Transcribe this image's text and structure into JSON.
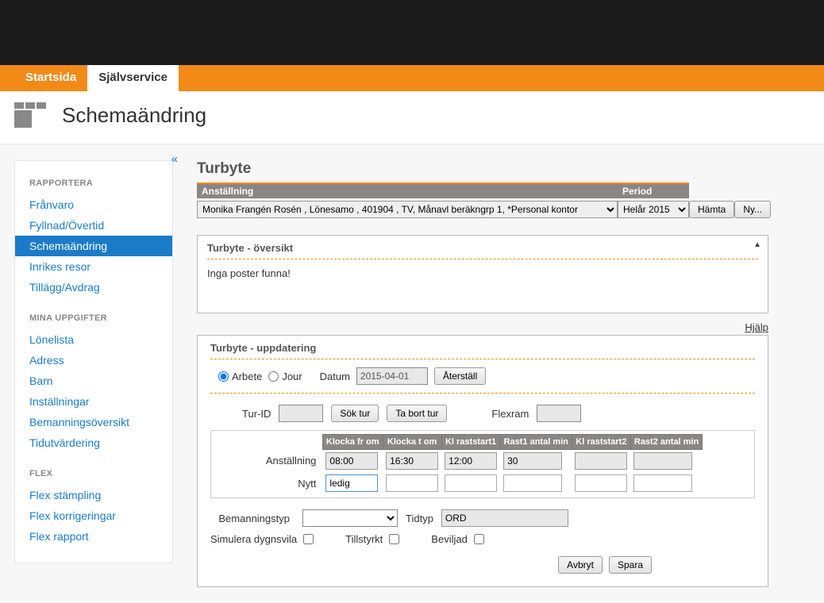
{
  "nav": {
    "tabs": [
      "Startsida",
      "Självservice"
    ],
    "active": 1
  },
  "page_title": "Schemaändring",
  "sidebar": {
    "collapse_glyph": "«",
    "sections": [
      {
        "heading": "RAPPORTERA",
        "items": [
          "Frånvaro",
          "Fyllnad/Övertid",
          "Schemaändring",
          "Inrikes resor",
          "Tillägg/Avdrag"
        ],
        "active_index": 2
      },
      {
        "heading": "MINA UPPGIFTER",
        "items": [
          "Lönelista",
          "Adress",
          "Barn",
          "Inställningar",
          "Bemanningsöversikt",
          "Tidutvärdering"
        ]
      },
      {
        "heading": "FLEX",
        "items": [
          "Flex stämpling",
          "Flex korrigeringar",
          "Flex rapport"
        ]
      }
    ]
  },
  "main": {
    "heading": "Turbyte",
    "filter": {
      "col_anst": "Anställning",
      "col_period": "Period",
      "anst_value": "Monika Frangén Rosén , Lönesamo , 401904 , TV, Månavl beräkngrp 1, *Personal kontor",
      "period_value": "Helår 2015",
      "btn_hamta": "Hämta",
      "btn_ny": "Ny..."
    },
    "overview": {
      "title": "Turbyte - översikt",
      "empty_text": "Inga poster funna!"
    },
    "help_link": "Hjälp",
    "update": {
      "title": "Turbyte - uppdatering",
      "radio_arbete": "Arbete",
      "radio_jour": "Jour",
      "lbl_datum": "Datum",
      "datum_value": "2015-04-01",
      "btn_aterstall": "Återställ",
      "lbl_turid": "Tur-ID",
      "btn_soktur": "Sök tur",
      "btn_tabort": "Ta bort tur",
      "lbl_flexram": "Flexram",
      "grid": {
        "headers": [
          "Klocka fr om",
          "Klocka t om",
          "Kl raststart1",
          "Rast1 antal min",
          "Kl raststart2",
          "Rast2 antal min"
        ],
        "row_anst_label": "Anställning",
        "row_anst": [
          "08:00",
          "16:30",
          "12:00",
          "30",
          "",
          ""
        ],
        "row_nytt_label": "Nytt",
        "row_nytt": [
          "ledig",
          "",
          "",
          "",
          "",
          ""
        ]
      },
      "lbl_btyp": "Bemanningstyp",
      "lbl_tidtyp": "Tidtyp",
      "tidtyp_value": "ORD",
      "chk_simulera": "Simulera dygnsvila",
      "chk_tillstyrkt": "Tillstyrkt",
      "chk_beviljad": "Beviljad",
      "btn_avbryt": "Avbryt",
      "btn_spara": "Spara"
    }
  }
}
